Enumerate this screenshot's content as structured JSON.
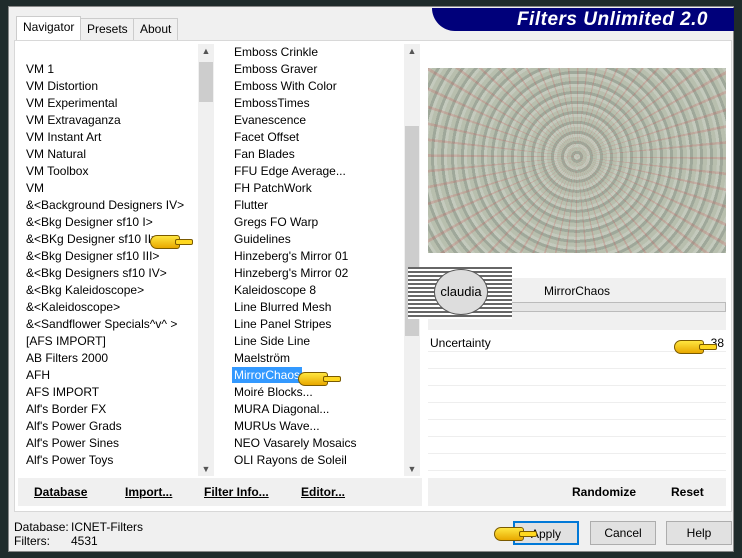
{
  "app_title": "Filters Unlimited 2.0",
  "tabs": [
    {
      "label": "Navigator",
      "active": true
    },
    {
      "label": "Presets"
    },
    {
      "label": "About"
    }
  ],
  "categories": [
    "",
    "VM 1",
    "VM Distortion",
    "VM Experimental",
    "VM Extravaganza",
    "VM Instant Art",
    "VM Natural",
    "VM Toolbox",
    "VM",
    "&<Background Designers IV>",
    "&<Bkg Designer sf10 I>",
    "&<BKg Designer sf10 II>",
    "&<Bkg Designer sf10 III>",
    "&<Bkg Designers sf10 IV>",
    "&<Bkg Kaleidoscope>",
    "&<Kaleidoscope>",
    "&<Sandflower Specials^v^ >",
    "[AFS IMPORT]",
    "AB Filters 2000",
    "AFH",
    "AFS IMPORT",
    "Alf's Border FX",
    "Alf's Power Grads",
    "Alf's Power Sines",
    "Alf's Power Toys"
  ],
  "filters": [
    "Emboss Crinkle",
    "Emboss Graver",
    "Emboss With Color",
    "EmbossTimes",
    "Evanescence",
    "Facet Offset",
    "Fan Blades",
    "FFU Edge Average...",
    "FH PatchWork",
    "Flutter",
    "Gregs FO Warp",
    "Guidelines",
    "Hinzeberg's Mirror 01",
    "Hinzeberg's Mirror 02",
    "Kaleidoscope 8",
    "Line Blurred Mesh",
    "Line Panel Stripes",
    "Line Side Line",
    "Maelström",
    "MirrorChaos",
    "Moiré Blocks...",
    "MURA Diagonal...",
    "MURUs Wave...",
    "NEO Vasarely Mosaics",
    "OLI Rayons de Soleil"
  ],
  "selected_filter": "MirrorChaos",
  "filter_title": "MirrorChaos",
  "watermark": "claudia",
  "params": [
    {
      "label": "Uncertainty",
      "value": "38"
    }
  ],
  "buttons": {
    "database": "Database",
    "import": "Import...",
    "filter_info": "Filter Info...",
    "editor": "Editor...",
    "randomize": "Randomize",
    "reset": "Reset",
    "apply": "Apply",
    "cancel": "Cancel",
    "help": "Help"
  },
  "status": {
    "database_label": "Database:",
    "database_value": "ICNET-Filters",
    "filters_label": "Filters:",
    "filters_value": "4531"
  }
}
